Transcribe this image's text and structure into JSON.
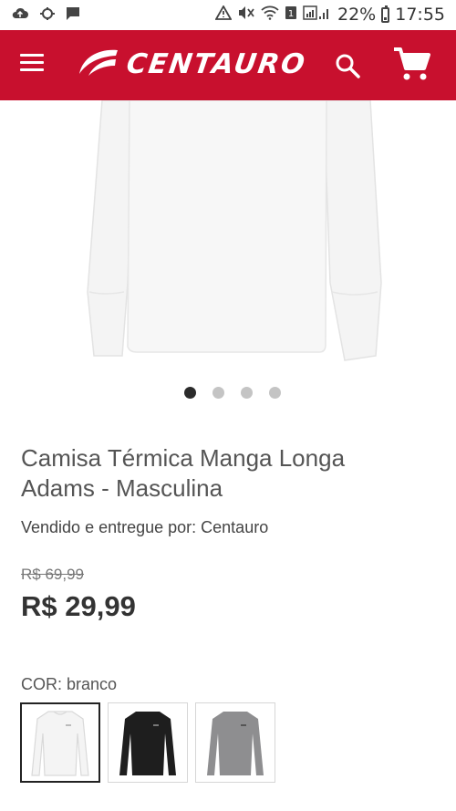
{
  "status_bar": {
    "battery_percent": "22%",
    "time": "17:55",
    "left_icons": [
      "cloud-upload-icon",
      "sync-icon",
      "message-icon"
    ],
    "right_icons": [
      "alert-icon",
      "mute-icon",
      "wifi-icon",
      "sim-icon",
      "signal-icon",
      "battery-icon"
    ]
  },
  "header": {
    "logo_text": "CENTAURO",
    "brand_color": "#c8102e",
    "menu_icon": "hamburger-menu-icon",
    "search_icon": "search-icon",
    "cart_icon": "shopping-cart-icon"
  },
  "carousel": {
    "total_slides": 4,
    "active_index": 0
  },
  "product": {
    "title": "Camisa Térmica Manga Longa Adams - Masculina",
    "seller": "Vendido e entregue por: Centauro",
    "old_price": "R$ 69,99",
    "price": "R$ 29,99",
    "color_label": "COR: branco",
    "colors": [
      {
        "name": "branco",
        "hex": "#f4f4f4",
        "selected": true
      },
      {
        "name": "preto",
        "hex": "#1e1e1e",
        "selected": false
      },
      {
        "name": "cinza",
        "hex": "#8e8e90",
        "selected": false
      }
    ]
  }
}
